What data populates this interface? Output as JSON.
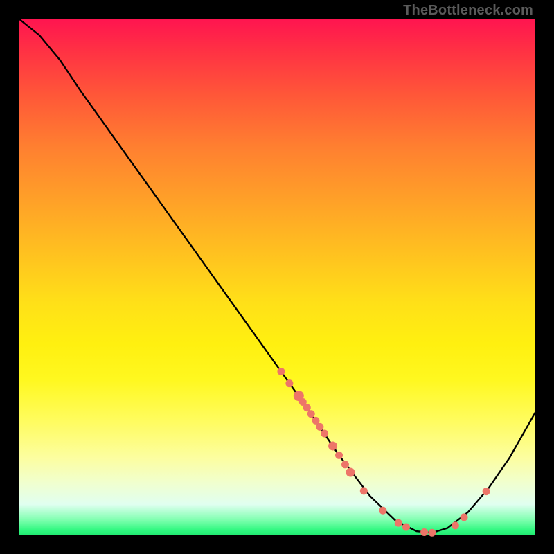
{
  "watermark": "TheBottleneck.com",
  "colors": {
    "background": "#000000",
    "curve_stroke": "#000000",
    "marker_fill": "#ed7568",
    "marker_stroke": "#ed7568"
  },
  "chart_data": {
    "type": "line",
    "title": "",
    "xlabel": "",
    "ylabel": "",
    "xlim": [
      0,
      100
    ],
    "ylim": [
      0,
      100
    ],
    "curve": [
      {
        "x": 0.0,
        "y": 100.0
      },
      {
        "x": 4.0,
        "y": 96.8
      },
      {
        "x": 8.0,
        "y": 92.0
      },
      {
        "x": 12.0,
        "y": 86.0
      },
      {
        "x": 20.0,
        "y": 74.8
      },
      {
        "x": 30.0,
        "y": 60.8
      },
      {
        "x": 40.0,
        "y": 46.8
      },
      {
        "x": 48.0,
        "y": 35.6
      },
      {
        "x": 55.0,
        "y": 25.8
      },
      {
        "x": 62.0,
        "y": 15.5
      },
      {
        "x": 68.0,
        "y": 7.6
      },
      {
        "x": 73.0,
        "y": 2.8
      },
      {
        "x": 77.0,
        "y": 0.8
      },
      {
        "x": 80.0,
        "y": 0.5
      },
      {
        "x": 83.0,
        "y": 1.4
      },
      {
        "x": 87.0,
        "y": 4.5
      },
      {
        "x": 91.0,
        "y": 9.2
      },
      {
        "x": 95.0,
        "y": 15.0
      },
      {
        "x": 100.0,
        "y": 23.8
      }
    ],
    "markers": [
      {
        "x": 50.8,
        "y": 31.7,
        "r": 5
      },
      {
        "x": 52.4,
        "y": 29.4,
        "r": 5
      },
      {
        "x": 54.2,
        "y": 27.0,
        "r": 7
      },
      {
        "x": 55.0,
        "y": 25.8,
        "r": 5
      },
      {
        "x": 55.8,
        "y": 24.7,
        "r": 5
      },
      {
        "x": 56.6,
        "y": 23.5,
        "r": 5
      },
      {
        "x": 57.5,
        "y": 22.2,
        "r": 5
      },
      {
        "x": 58.3,
        "y": 21.0,
        "r": 5
      },
      {
        "x": 59.2,
        "y": 19.7,
        "r": 5
      },
      {
        "x": 60.8,
        "y": 17.3,
        "r": 6
      },
      {
        "x": 62.0,
        "y": 15.5,
        "r": 5
      },
      {
        "x": 63.2,
        "y": 13.7,
        "r": 5
      },
      {
        "x": 64.2,
        "y": 12.2,
        "r": 6
      },
      {
        "x": 66.8,
        "y": 8.6,
        "r": 5
      },
      {
        "x": 70.5,
        "y": 4.8,
        "r": 5
      },
      {
        "x": 73.5,
        "y": 2.4,
        "r": 5
      },
      {
        "x": 75.0,
        "y": 1.6,
        "r": 5
      },
      {
        "x": 78.5,
        "y": 0.6,
        "r": 5
      },
      {
        "x": 80.0,
        "y": 0.5,
        "r": 5
      },
      {
        "x": 84.5,
        "y": 1.9,
        "r": 5
      },
      {
        "x": 86.2,
        "y": 3.5,
        "r": 5
      },
      {
        "x": 90.5,
        "y": 8.5,
        "r": 5
      }
    ]
  }
}
